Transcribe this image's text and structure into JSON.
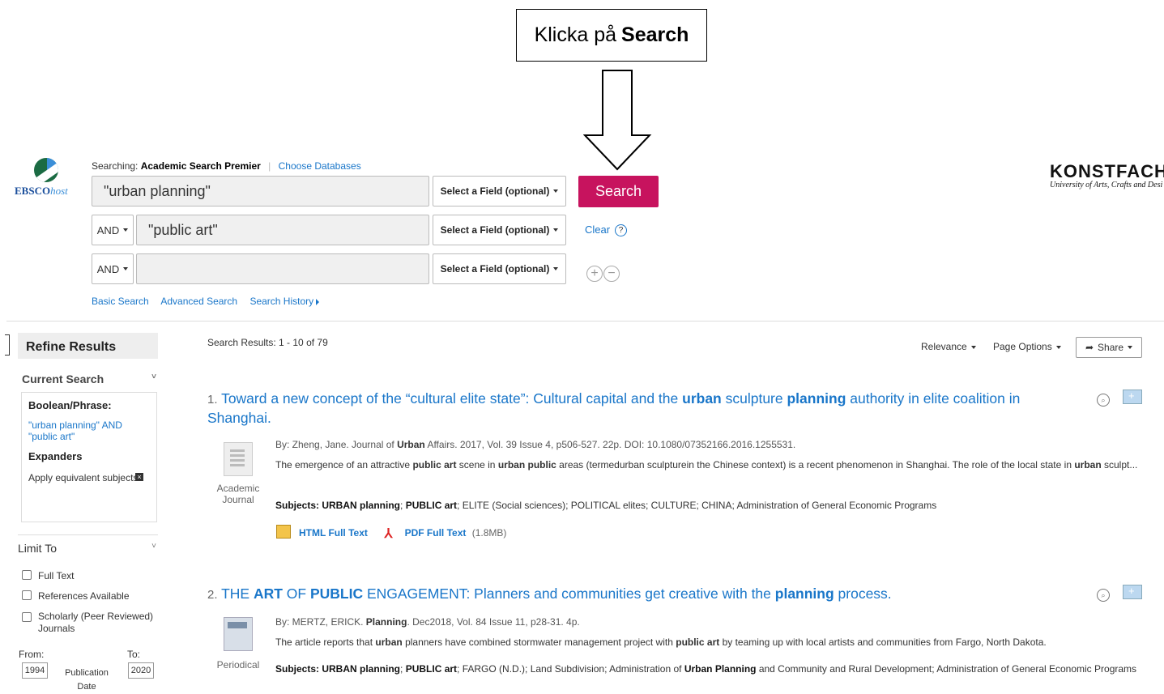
{
  "callout": {
    "prefix": "Klicka på",
    "bold": "Search"
  },
  "logo": {
    "brand": "EBSCO",
    "host": "host"
  },
  "searching": {
    "label": "Searching:",
    "database": "Academic Search Premier",
    "choose": "Choose Databases"
  },
  "rows": [
    {
      "bool": "",
      "query": "\"urban planning\"",
      "field": "Select a Field (optional)"
    },
    {
      "bool": "AND",
      "query": "\"public art\"",
      "field": "Select a Field (optional)"
    },
    {
      "bool": "AND",
      "query": "",
      "field": "Select a Field (optional)"
    }
  ],
  "search_button": "Search",
  "clear": "Clear",
  "help_icon": "?",
  "links": {
    "basic": "Basic Search",
    "advanced": "Advanced Search",
    "history": "Search History"
  },
  "institution": {
    "name": "KONSTFACH",
    "subtitle": "University of Arts, Crafts and Desi"
  },
  "sidebar": {
    "refine": "Refine Results",
    "current_search": "Current Search",
    "boolean_label": "Boolean/Phrase:",
    "boolean_value": "\"urban planning\" AND \"public art\"",
    "expanders_label": "Expanders",
    "expander_value": "Apply equivalent subjects",
    "limit_to": "Limit To",
    "limits": [
      "Full Text",
      "References Available",
      "Scholarly (Peer Reviewed) Journals"
    ],
    "from_label": "From:",
    "to_label": "To:",
    "from_year": "1994",
    "to_year": "2020",
    "pubdate_label": "Publication Date"
  },
  "results_header": {
    "label": "Search Results:",
    "range": "1 - 10 of 79",
    "relevance": "Relevance",
    "page_options": "Page Options",
    "share": "Share"
  },
  "results": [
    {
      "num": "1.",
      "title_parts": [
        "Toward a new concept of the “cultural elite state”: Cultural capital and the ",
        "urban",
        " sculpture ",
        "planning",
        " authority in elite coalition in Shanghai."
      ],
      "meta_parts": [
        "By: Zheng, Jane. Journal of ",
        "Urban",
        " Affairs. 2017, Vol. 39 Issue 4, p506-527. 22p. DOI: 10.1080/07352166.2016.1255531."
      ],
      "abstract_parts": [
        "The emergence of an attractive ",
        "public art",
        " scene in ",
        "urban public",
        " areas (termedurban sculpturein the Chinese context) is a recent phenomenon in Shanghai. The role of the local state in ",
        "urban",
        " sculpt..."
      ],
      "subjects_parts": [
        "Subjects: URBAN planning",
        "; ",
        "PUBLIC art",
        "; ELITE (Social sciences); POLITICAL elites; CULTURE; CHINA; Administration of General Economic Programs"
      ],
      "ptype": "Academic Journal",
      "html_ft": "HTML Full Text",
      "pdf_ft": "PDF Full Text",
      "pdf_size": "(1.8MB)"
    },
    {
      "num": "2.",
      "title_parts": [
        "THE ",
        "ART",
        " OF ",
        "PUBLIC",
        " ENGAGEMENT: Planners and communities get creative with the ",
        "planning",
        " process."
      ],
      "meta_parts": [
        "By: MERTZ, ERICK. ",
        "Planning",
        ". Dec2018, Vol. 84 Issue 11, p28-31. 4p."
      ],
      "abstract_parts": [
        "The article reports that ",
        "urban",
        " planners have combined stormwater management project with ",
        "public art",
        " by teaming up with local artists and communities from Fargo, North Dakota."
      ],
      "subjects_parts": [
        "Subjects: URBAN planning",
        "; ",
        "PUBLIC art",
        "; FARGO (N.D.); Land Subdivision; Administration of ",
        "Urban Planning",
        " and Community and Rural Development; Administration of General Economic Programs"
      ],
      "ptype": "Periodical"
    }
  ]
}
